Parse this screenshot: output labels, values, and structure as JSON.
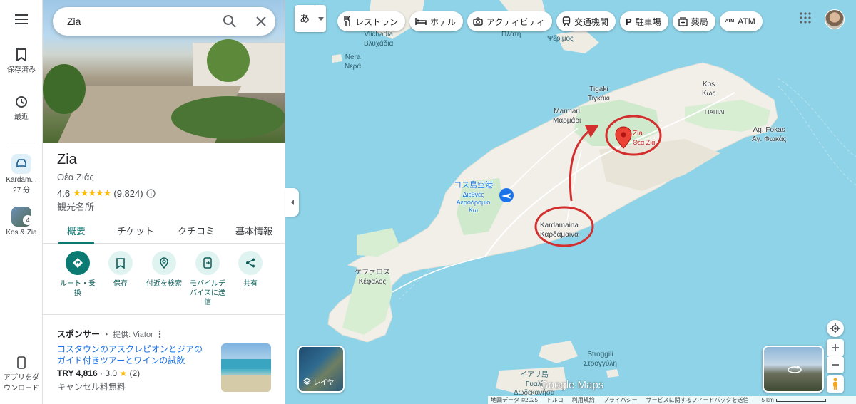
{
  "rail": {
    "saved_label": "保存済み",
    "recent_label": "最近",
    "trip_label_1": "Kardam...",
    "trip_label_2": "27 分",
    "collection_count": "4",
    "collection_label": "Kos & Zia",
    "app_label_1": "アプリをダ",
    "app_label_2": "ウンロード"
  },
  "search": {
    "value": "Zia"
  },
  "place": {
    "name": "Zia",
    "native_name": "Θέα Ζιάς",
    "rating": "4.6",
    "stars": "★★★★★",
    "review_count": "(9,824)",
    "category": "観光名所"
  },
  "tabs": [
    "概要",
    "チケット",
    "クチコミ",
    "基本情報"
  ],
  "actions": {
    "route": [
      "ルート・乗",
      "換"
    ],
    "save": "保存",
    "nearby": "付近を検索",
    "send": [
      "モバイルデ",
      "バイスに送",
      "信"
    ],
    "share": "共有"
  },
  "sponsor": {
    "label": "スポンサー",
    "provider": "・ 提供: Viator",
    "title": "コスタウンのアスクレピオンとジアのガイド付きツアーとワインの試飲",
    "price": "TRY 4,816",
    "rating": "· 3.0",
    "reviews": "(2)",
    "cancel": "キャンセル料無料"
  },
  "map": {
    "lang_button": "あ",
    "chips": [
      "レストラン",
      "ホテル",
      "アクティビティ",
      "交通機関",
      "駐車場",
      "薬局",
      "ATM"
    ],
    "labels": {
      "vlichadia": [
        "Vlichadia",
        "Βλυχάδια"
      ],
      "plati": "Πλάτη",
      "psermos": "Ψέριμος",
      "nera": [
        "Nera",
        "Νερά"
      ],
      "tigaki": [
        "Tigaki",
        "Τιγκάκι"
      ],
      "marmari": [
        "Marmari",
        "Μαρμάρι"
      ],
      "kos": [
        "Kos",
        "Κως"
      ],
      "giapili": "ΓΙΑΠΙΛΙ",
      "agfokas": [
        "Ag. Fokas",
        "Αγ. Φωκάς"
      ],
      "zia_pin": [
        "Zia",
        "Θέα Ζιά"
      ],
      "airport": [
        "コス島空港",
        "Διεθνές",
        "Αεροδρόμιο",
        "Κω"
      ],
      "kardamaina": [
        "Kardamaina",
        "Καρδάμαινα"
      ],
      "kefalos": [
        "ケファロス",
        "Κέφαλος"
      ],
      "stroggili": [
        "Stroggili",
        "Στρογγύλη"
      ],
      "yali": [
        "イアリ島",
        "Γυαλί",
        "Δωδεκανήσα"
      ]
    },
    "layer_label": "レイヤ",
    "google_maps": "Google Maps",
    "footer": [
      "地図データ ©2025",
      "トルコ",
      "利用規約",
      "プライバシー",
      "サービスに関するフィードバックを送信",
      "5 km"
    ]
  }
}
